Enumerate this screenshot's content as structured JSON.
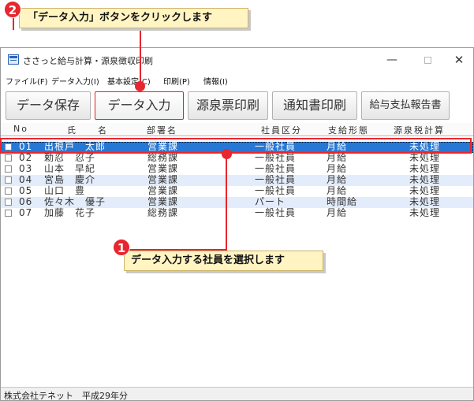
{
  "window": {
    "title": "ささっと給与計算・源泉徴収印刷",
    "controls": {
      "minimize": "—",
      "close": "✕"
    }
  },
  "menu": [
    {
      "label": "ファイル(F)"
    },
    {
      "label": "データ入力(I)"
    },
    {
      "label": "基本設定(C)"
    },
    {
      "label": "印刷(P)"
    },
    {
      "label": "情報(I)"
    }
  ],
  "toolbar": {
    "buttons": [
      {
        "label": "データ保存"
      },
      {
        "label": "データ入力"
      },
      {
        "label": "源泉票印刷"
      },
      {
        "label": "通知書印刷"
      },
      {
        "label": "給与支払報告書"
      }
    ]
  },
  "grid": {
    "columns": [
      "No",
      "氏　　名",
      "部署名",
      "社員区分",
      "支給形態",
      "源泉税計算"
    ],
    "rows": [
      {
        "no": "01",
        "name": "出根戸　太郎",
        "dept": "営業課",
        "type": "一般社員",
        "pay": "月給",
        "tax": "未処理"
      },
      {
        "no": "02",
        "name": "勅忍　忍子",
        "dept": "総務課",
        "type": "一般社員",
        "pay": "月給",
        "tax": "未処理"
      },
      {
        "no": "03",
        "name": "山本　早紀",
        "dept": "営業課",
        "type": "一般社員",
        "pay": "月給",
        "tax": "未処理"
      },
      {
        "no": "04",
        "name": "宮島　慶介",
        "dept": "営業課",
        "type": "一般社員",
        "pay": "月給",
        "tax": "未処理"
      },
      {
        "no": "05",
        "name": "山口　豊",
        "dept": "営業課",
        "type": "一般社員",
        "pay": "月給",
        "tax": "未処理"
      },
      {
        "no": "06",
        "name": "佐々木　優子",
        "dept": "営業課",
        "type": "パート",
        "pay": "時間給",
        "tax": "未処理"
      },
      {
        "no": "07",
        "name": "加藤　花子",
        "dept": "総務課",
        "type": "一般社員",
        "pay": "月給",
        "tax": "未処理"
      }
    ],
    "selected_index": 0
  },
  "status": {
    "text": "株式会社テネット　平成29年分"
  },
  "callouts": {
    "step2": {
      "number": "2",
      "text": "「データ入力」ボタンをクリックします"
    },
    "step1": {
      "number": "1",
      "text": "データ入力する社員を選択します"
    }
  },
  "colors": {
    "accent": "#e8262e",
    "selection": "#2678d4",
    "callout_bg": "#fff4c2",
    "alt_row": "#e3ecfa"
  }
}
